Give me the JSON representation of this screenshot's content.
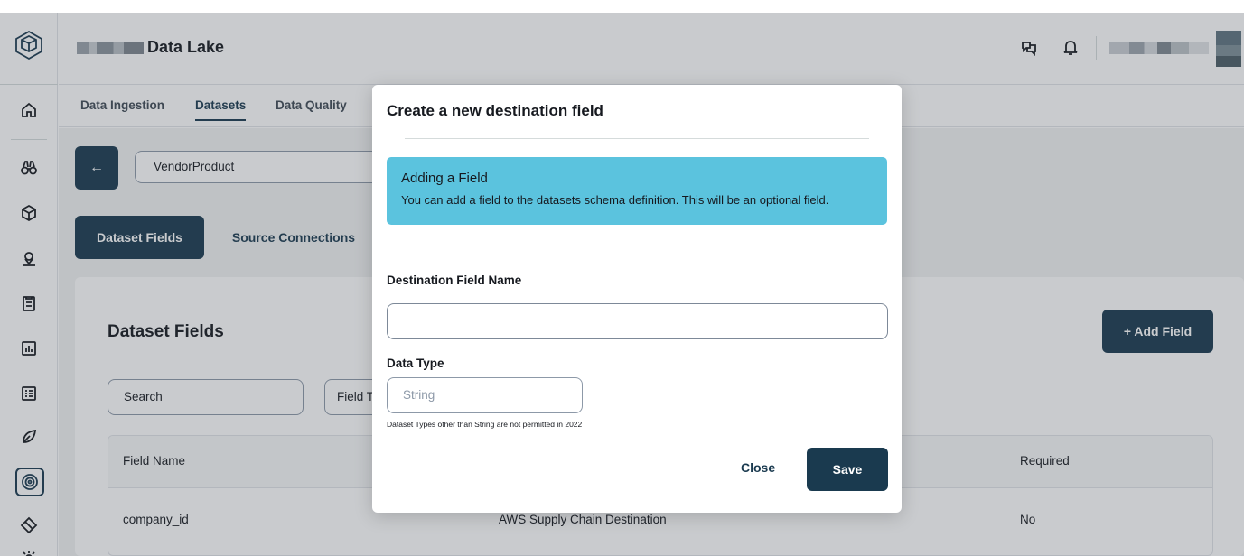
{
  "header": {
    "title": "Data Lake"
  },
  "tabs": [
    {
      "label": "Data Ingestion"
    },
    {
      "label": "Datasets"
    },
    {
      "label": "Data Quality"
    }
  ],
  "dataset": {
    "selected": "VendorProduct"
  },
  "pills": [
    {
      "label": "Dataset Fields"
    },
    {
      "label": "Source Connections"
    }
  ],
  "card": {
    "title": "Dataset Fields",
    "add_label": "+ Add Field",
    "search_placeholder": "Search",
    "filter_label": "Field Type"
  },
  "table": {
    "headers": [
      "Field Name",
      "Required"
    ],
    "rows": [
      {
        "field_name": "company_id",
        "source": "AWS Supply Chain Destination",
        "required": "No"
      }
    ]
  },
  "modal": {
    "title": "Create a new destination field",
    "alert_title": "Adding a Field",
    "alert_body": "You can add a field to the datasets schema definition. This will be an optional field.",
    "name_label": "Destination Field Name",
    "name_value": "",
    "type_label": "Data Type",
    "type_placeholder": "String",
    "hint": "Dataset Types other than String are not permitted in 2022",
    "close_label": "Close",
    "save_label": "Save"
  },
  "rail_icons": [
    "logo-icon",
    "home-icon",
    "binoculars-icon",
    "cube-icon",
    "location-icon",
    "clipboard-icon",
    "chart-icon",
    "list-icon",
    "leaf-icon",
    "target-icon",
    "diamond-icon",
    "gear-icon"
  ],
  "header_icons": [
    "chat-icon",
    "bell-icon"
  ],
  "colors": {
    "primary": "#1a3a4f",
    "alert": "#5bc3de",
    "background": "#f2f3f3"
  }
}
